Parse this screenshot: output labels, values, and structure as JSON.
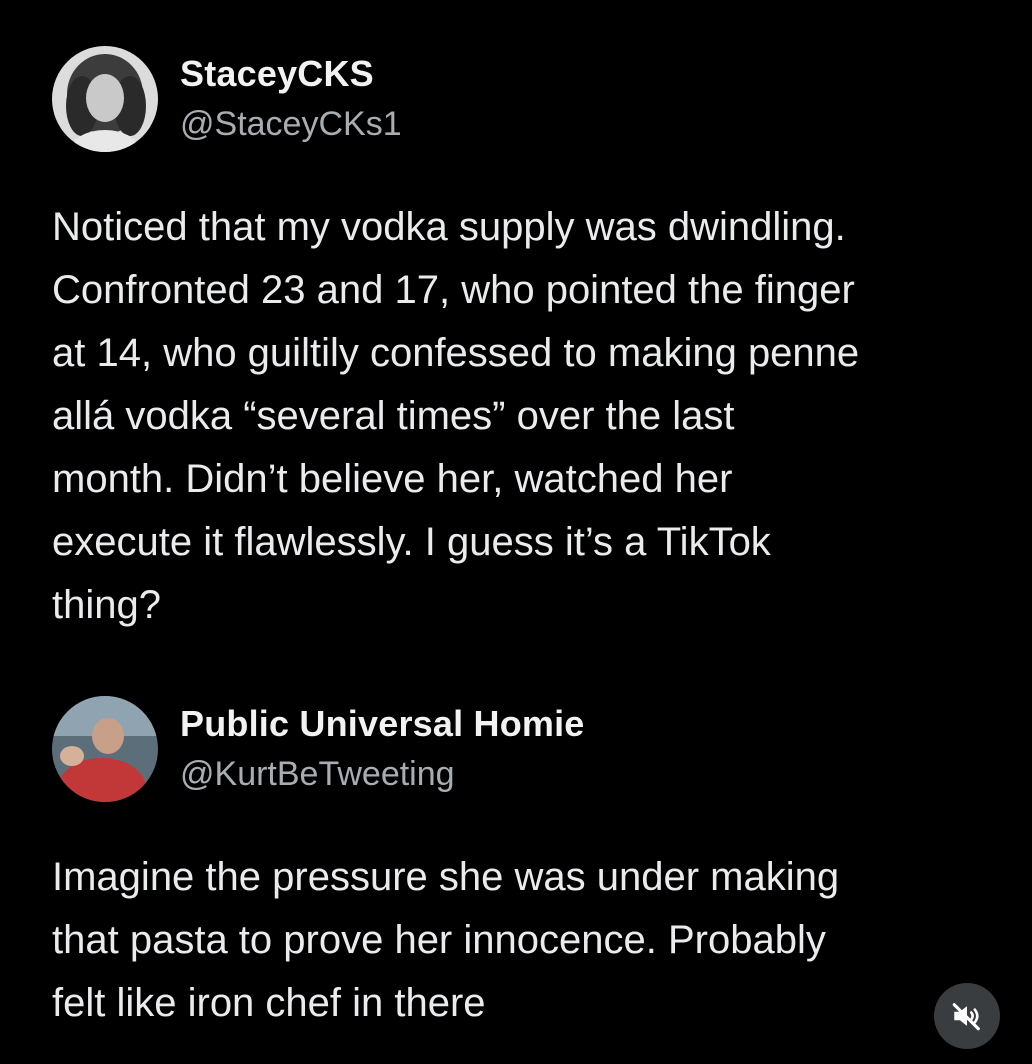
{
  "posts": [
    {
      "display_name": "StaceyCKS",
      "handle": "@StaceyCKs1",
      "text": "Noticed that my vodka supply was dwindling.\nConfronted 23 and 17, who pointed the finger\nat 14, who guiltily confessed to making penne\nallá vodka “several times” over the last\nmonth. Didn’t believe her, watched her\nexecute it flawlessly. I guess it’s a TikTok\nthing?"
    },
    {
      "display_name": "Public Universal Homie",
      "handle": "@KurtBeTweeting",
      "text": "Imagine the pressure she was under making\nthat pasta to prove her innocence. Probably\nfelt like iron chef in there"
    }
  ],
  "controls": {
    "mute_icon": "speaker-muted-icon"
  }
}
